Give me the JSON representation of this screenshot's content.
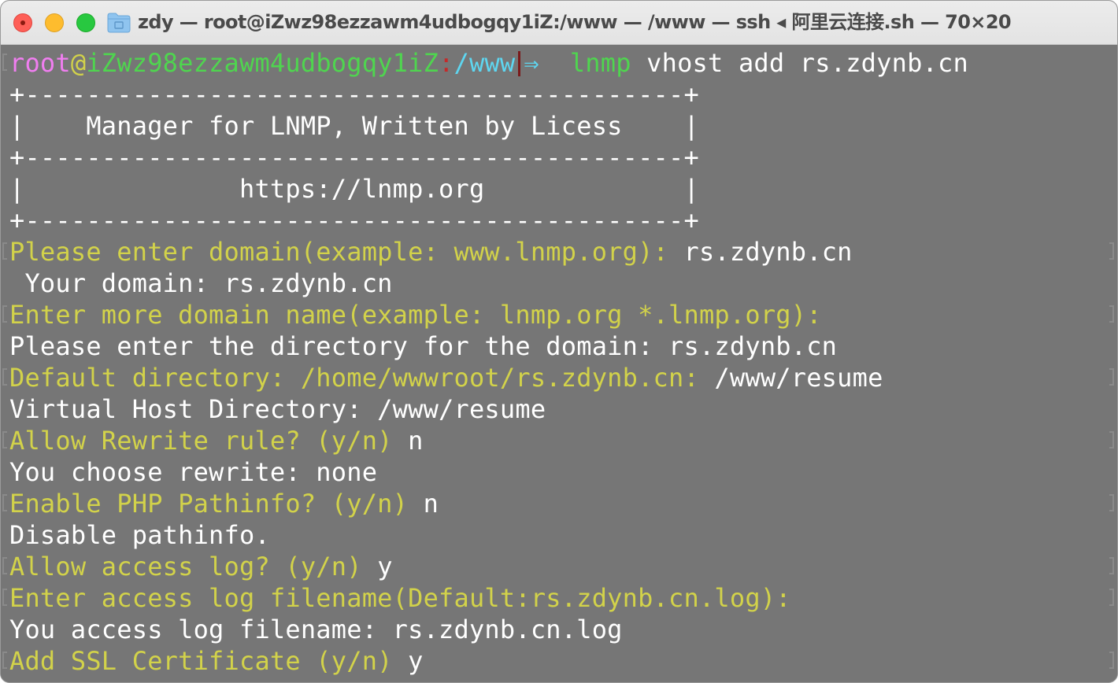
{
  "window": {
    "title": "zdy — root@iZwz98ezzawm4udbogqy1iZ:/www — /www — ssh ◂ 阿里云连接.sh — 70×20"
  },
  "prompt": {
    "user": "root",
    "at": "@",
    "host": "iZwz98ezzawm4udbogqy1iZ",
    "colon": ":",
    "path": "/www",
    "arrow": "⇒",
    "command": "lnmp",
    "args": " vhost add rs.zdynb.cn"
  },
  "banner": {
    "border": "+-------------------------------------------+",
    "title_row": "|    Manager for LNMP, Written by Licess    |",
    "url_row": "|              https://lnmp.org             |"
  },
  "lines": [
    {
      "q": "Please enter domain(example: www.lnmp.org): ",
      "a": "rs.zdynb.cn"
    },
    {
      "plain": " Your domain: rs.zdynb.cn"
    },
    {
      "q": "Enter more domain name(example: lnmp.org *.lnmp.org): ",
      "a": ""
    },
    {
      "plain": "Please enter the directory for the domain: rs.zdynb.cn"
    },
    {
      "q": "Default directory: /home/wwwroot/rs.zdynb.cn: ",
      "a": "/www/resume"
    },
    {
      "plain": "Virtual Host Directory: /www/resume"
    },
    {
      "q": "Allow Rewrite rule? (y/n) ",
      "a": "n"
    },
    {
      "plain": "You choose rewrite: none"
    },
    {
      "q": "Enable PHP Pathinfo? (y/n) ",
      "a": "n"
    },
    {
      "plain": "Disable pathinfo."
    },
    {
      "q": "Allow access log? (y/n) ",
      "a": "y"
    },
    {
      "q": "Enter access log filename(Default:rs.zdynb.cn.log): ",
      "a": ""
    },
    {
      "plain": "You access log filename: rs.zdynb.cn.log"
    },
    {
      "q": "Add SSL Certificate (y/n) ",
      "a": "y"
    }
  ],
  "colors": {
    "terminal_bg": "#767676",
    "prompt_text": "#d2d24a",
    "user": "#f07ef0",
    "host": "#4fd54f",
    "path": "#5ed6f0"
  }
}
